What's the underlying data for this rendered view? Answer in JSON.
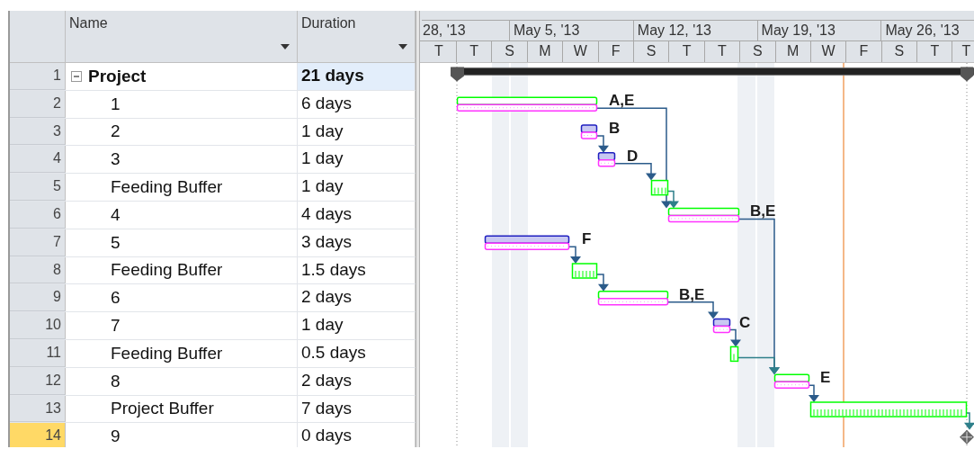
{
  "columns": [
    {
      "label": "Name"
    },
    {
      "label": "Duration"
    }
  ],
  "timescale": {
    "weeks": [
      "28, '13",
      "May 5, '13",
      "May 12, '13",
      "May 19, '13",
      "May 26, '13"
    ],
    "days": [
      "T",
      "T",
      "S",
      "M",
      "W",
      "F",
      "S",
      "T",
      "T",
      "S",
      "M",
      "W",
      "F",
      "S",
      "T",
      "T"
    ]
  },
  "tasks": [
    {
      "row": "1",
      "name": "Project",
      "duration": "21 days",
      "kind": "summary",
      "expanded": true,
      "selected": false,
      "duration_selected": true,
      "children": [
        {
          "row": "2",
          "name": "1",
          "duration": "6 days",
          "kind": "task",
          "color": "#00ff00",
          "bar_label": "A,E",
          "selected": false,
          "duration_selected": false
        },
        {
          "row": "3",
          "name": "2",
          "duration": "1 day",
          "kind": "task",
          "color": "#2020c0",
          "bar_label": "B",
          "selected": false,
          "duration_selected": false
        },
        {
          "row": "4",
          "name": "3",
          "duration": "1 day",
          "kind": "task",
          "color": "#2020c0",
          "bar_label": "D",
          "selected": false,
          "duration_selected": false
        },
        {
          "row": "5",
          "name": "Feeding Buffer",
          "duration": "1 day",
          "kind": "buffer",
          "color": "#00ff00",
          "selected": false,
          "duration_selected": false
        },
        {
          "row": "6",
          "name": "4",
          "duration": "4 days",
          "kind": "task",
          "color": "#00ff00",
          "bar_label": "B,E",
          "selected": false,
          "duration_selected": false
        },
        {
          "row": "7",
          "name": "5",
          "duration": "3 days",
          "kind": "task",
          "color": "#2020c0",
          "bar_label": "F",
          "selected": false,
          "duration_selected": false
        },
        {
          "row": "8",
          "name": "Feeding Buffer",
          "duration": "1.5 days",
          "kind": "buffer",
          "color": "#00ff00",
          "selected": false,
          "duration_selected": false
        },
        {
          "row": "9",
          "name": "6",
          "duration": "2 days",
          "kind": "task",
          "color": "#00ff00",
          "bar_label": "B,E",
          "selected": false,
          "duration_selected": false
        },
        {
          "row": "10",
          "name": "7",
          "duration": "1 day",
          "kind": "task",
          "color": "#2020c0",
          "bar_label": "C",
          "selected": false,
          "duration_selected": false
        },
        {
          "row": "11",
          "name": "Feeding Buffer",
          "duration": "0.5 days",
          "kind": "buffer",
          "color": "#00ff00",
          "selected": false,
          "duration_selected": false
        },
        {
          "row": "12",
          "name": "8",
          "duration": "2 days",
          "kind": "task",
          "color": "#00ff00",
          "bar_label": "E",
          "selected": false,
          "duration_selected": false
        },
        {
          "row": "13",
          "name": "Project Buffer",
          "duration": "7 days",
          "kind": "buffer",
          "color": "#00ff00",
          "selected": false,
          "duration_selected": false
        },
        {
          "row": "14",
          "name": "9",
          "duration": "0 days",
          "kind": "milestone",
          "selected": true,
          "duration_selected": false
        }
      ]
    }
  ]
}
